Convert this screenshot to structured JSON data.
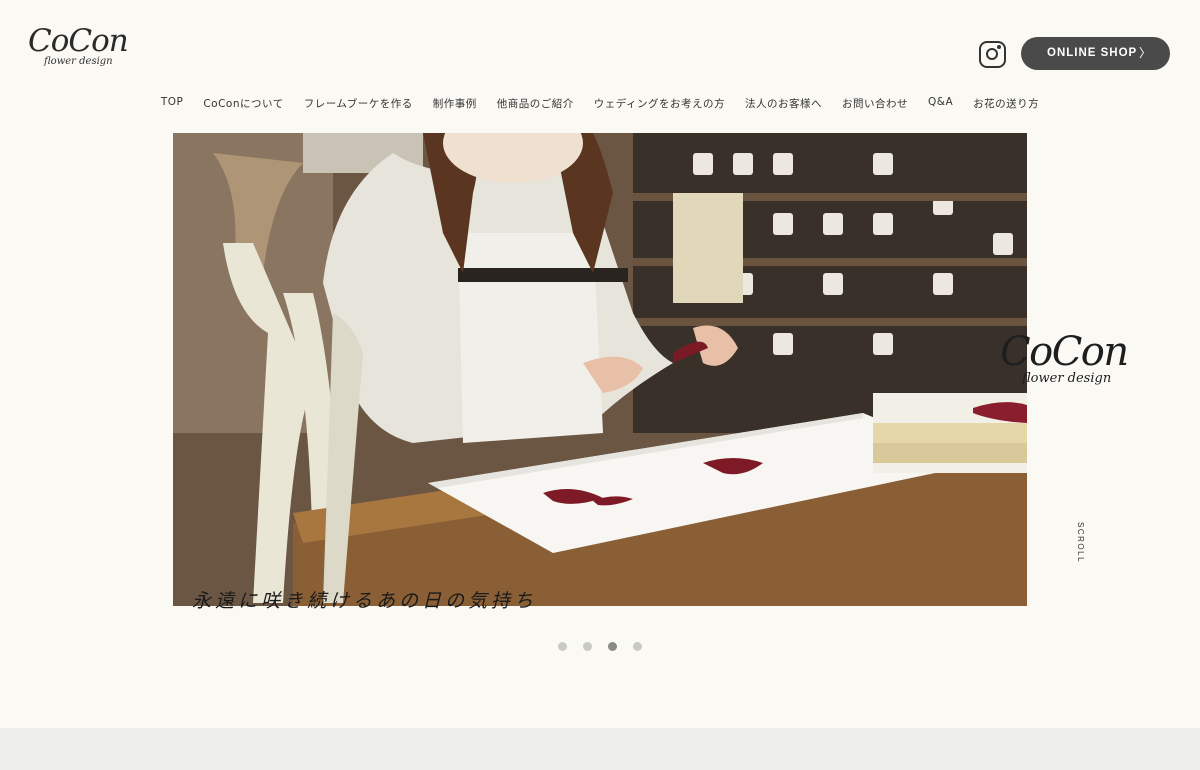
{
  "brand": {
    "logo_main": "CoCon",
    "logo_sub": "flower design"
  },
  "header": {
    "shop_button": "ONLINE SHOP",
    "shop_chevron": "〉",
    "instagram_icon": "instagram-icon"
  },
  "nav": {
    "items": [
      "TOP",
      "CoConについて",
      "フレームブーケを作る",
      "制作事例",
      "他商品のご紹介",
      "ウェディングをお考えの方",
      "法人のお客様へ",
      "お問い合わせ",
      "Q&A",
      "お花の送り方"
    ]
  },
  "hero": {
    "brand_main": "CoCon",
    "brand_sub": "flower design",
    "tagline": "永遠に咲き続けるあの日の気持ち",
    "scroll_label": "SCROLL"
  },
  "slider": {
    "count": 4,
    "active_index": 2
  },
  "colors": {
    "background": "#faf9f4",
    "button": "#4a4a4a",
    "footer": "#eeefeb"
  }
}
